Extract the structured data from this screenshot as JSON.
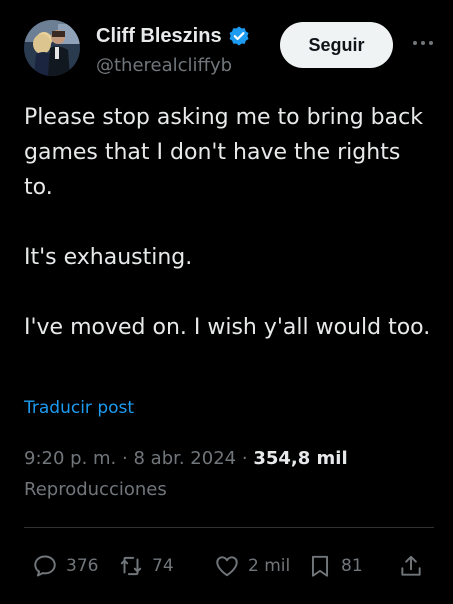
{
  "author": {
    "display_name": "Cliff Bleszins",
    "handle": "@therealcliffyb",
    "avatar_icon": "avatar-photo",
    "verified_icon": "verified-badge-icon",
    "verified_color": "#1d9bf0"
  },
  "header": {
    "follow_label": "Seguir",
    "more_icon": "more-horizontal-icon"
  },
  "tweet": {
    "paragraphs": [
      "Please stop asking me to bring back games that I don't have the rights to.",
      "It's exhausting.",
      "I've moved on. I wish y'all would too."
    ],
    "translate_label": "Traducir post"
  },
  "meta": {
    "time": "9:20 p. m.",
    "separator": "·",
    "date": "8 abr. 2024",
    "views_count": "354,8 mil",
    "views_label": "Reproducciones"
  },
  "actions": {
    "replies": {
      "count": "376",
      "icon": "reply-icon"
    },
    "reposts": {
      "count": "74",
      "icon": "repost-icon"
    },
    "likes": {
      "count": "2 mil",
      "icon": "heart-icon"
    },
    "bookmarks": {
      "count": "81",
      "icon": "bookmark-icon"
    },
    "share": {
      "icon": "share-icon"
    }
  },
  "colors": {
    "background": "#000000",
    "text": "#e7e9ea",
    "secondary": "#71767b",
    "link": "#1d9bf0",
    "button_bg": "#eff3f4",
    "divider": "#2f3336"
  }
}
